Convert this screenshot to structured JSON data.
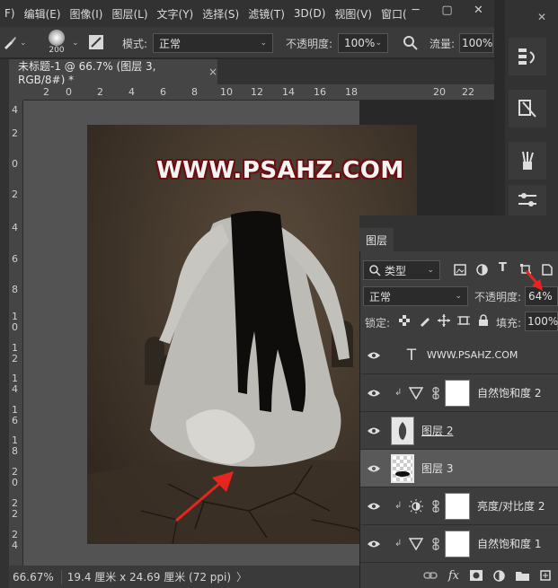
{
  "menu": {
    "items": [
      "F)",
      "编辑(E)",
      "图像(I)",
      "图层(L)",
      "文字(Y)",
      "选择(S)",
      "滤镜(T)",
      "3D(D)",
      "视图(V)",
      "窗口("
    ],
    "minimize": "─",
    "restore": "▢",
    "close": "✕"
  },
  "options": {
    "brush_size": "200",
    "mode_label": "模式:",
    "mode_value": "正常",
    "opacity_label": "不透明度:",
    "opacity_value": "100%",
    "flow_label": "流量:",
    "flow_value": "100%"
  },
  "document": {
    "tab_title": "未标题-1 @ 66.7% (图层 3, RGB/8#) *",
    "tab_close": "×",
    "watermark": "WWW.PSAHZ.COM"
  },
  "rulers": {
    "h_ticks": [
      "2",
      "0",
      "2",
      "4",
      "6",
      "8",
      "10",
      "12",
      "14",
      "16",
      "18",
      "20",
      "22"
    ],
    "v_ticks": [
      "4",
      "2",
      "0",
      "2",
      "4",
      "6",
      "8",
      "1 0",
      "1 2",
      "1 4",
      "1 6",
      "1 8",
      "2 0",
      "2 2",
      "2 4"
    ]
  },
  "status": {
    "zoom": "66.67%",
    "doc_size": "19.4 厘米 x 24.69 厘米 (72 ppi)",
    "arrow": "〉"
  },
  "layers_panel": {
    "tab_label": "图层",
    "filter_kind": "类型",
    "blend_mode": "正常",
    "opacity_label": "不透明度:",
    "opacity_value": "64%",
    "lock_label": "锁定:",
    "fill_label": "填充:",
    "fill_value": "100%",
    "layers": [
      {
        "name": "WWW.PSAHZ.COM",
        "type": "text"
      },
      {
        "name": "自然饱和度 2",
        "type": "vibrance"
      },
      {
        "name": "图层 2",
        "type": "pixel"
      },
      {
        "name": "图层 3",
        "type": "pixel"
      },
      {
        "name": "亮度/对比度 2",
        "type": "brightness"
      },
      {
        "name": "自然饱和度 1",
        "type": "vibrance"
      }
    ],
    "footer_fx": "fx"
  },
  "colors": {
    "annotation_arrow": "#e8241f",
    "panel_bg": "#3d3d3d",
    "active_row": "#595959"
  }
}
